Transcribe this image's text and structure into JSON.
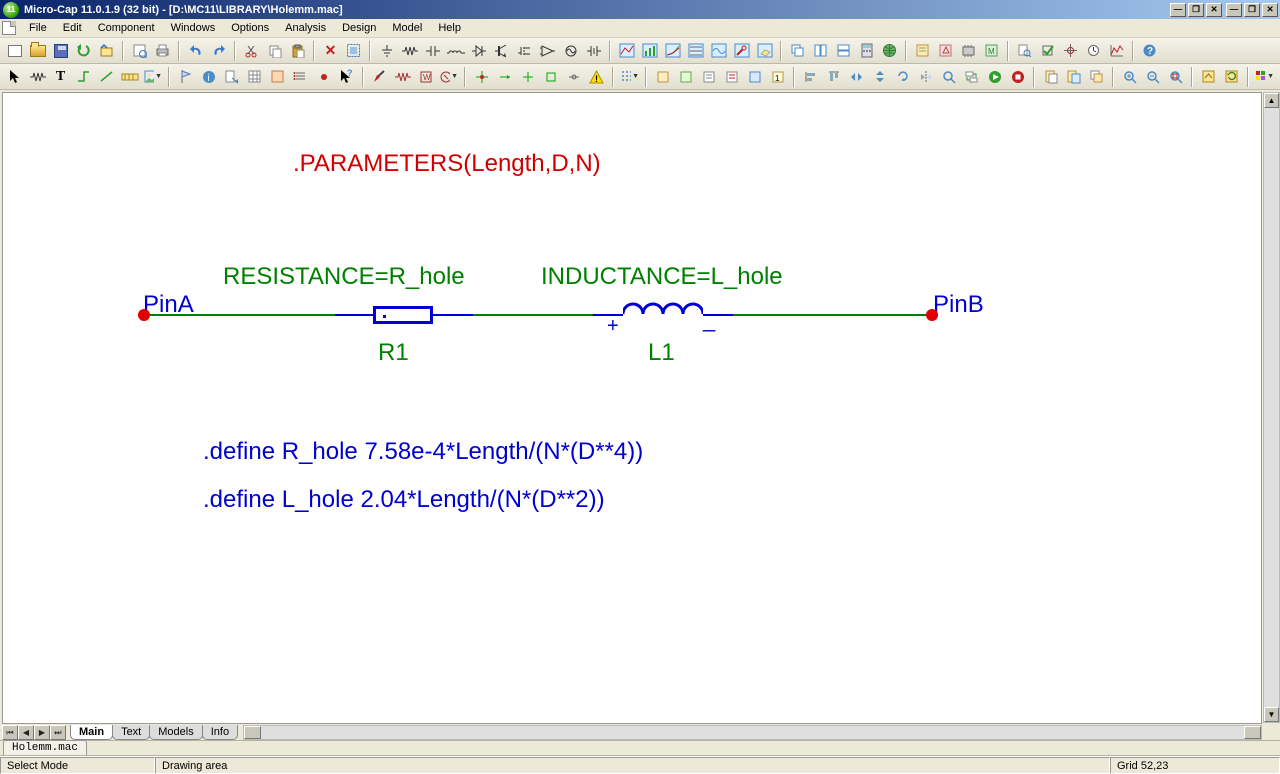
{
  "title": "Micro-Cap 11.0.1.9 (32 bit) - [D:\\MC11\\LIBRARY\\Holemm.mac]",
  "menus": [
    "File",
    "Edit",
    "Component",
    "Windows",
    "Options",
    "Analysis",
    "Design",
    "Model",
    "Help"
  ],
  "schematic": {
    "parameters_text": ".PARAMETERS(Length,D,N)",
    "resistance_text": "RESISTANCE=R_hole",
    "inductance_text": "INDUCTANCE=L_hole",
    "pin_a": "PinA",
    "pin_b": "PinB",
    "r_label": "R1",
    "l_label": "L1",
    "plus": "+",
    "minus": "_",
    "define_r": ".define R_hole 7.58e-4*Length/(N*(D**4))",
    "define_l": ".define L_hole 2.04*Length/(N*(D**2))"
  },
  "canvas_tabs": [
    "Main",
    "Text",
    "Models",
    "Info"
  ],
  "active_canvas_tab": "Main",
  "file_tab": "Holemm.mac",
  "status": {
    "mode": "Select Mode",
    "area": "Drawing area",
    "grid": "Grid 52,23"
  }
}
